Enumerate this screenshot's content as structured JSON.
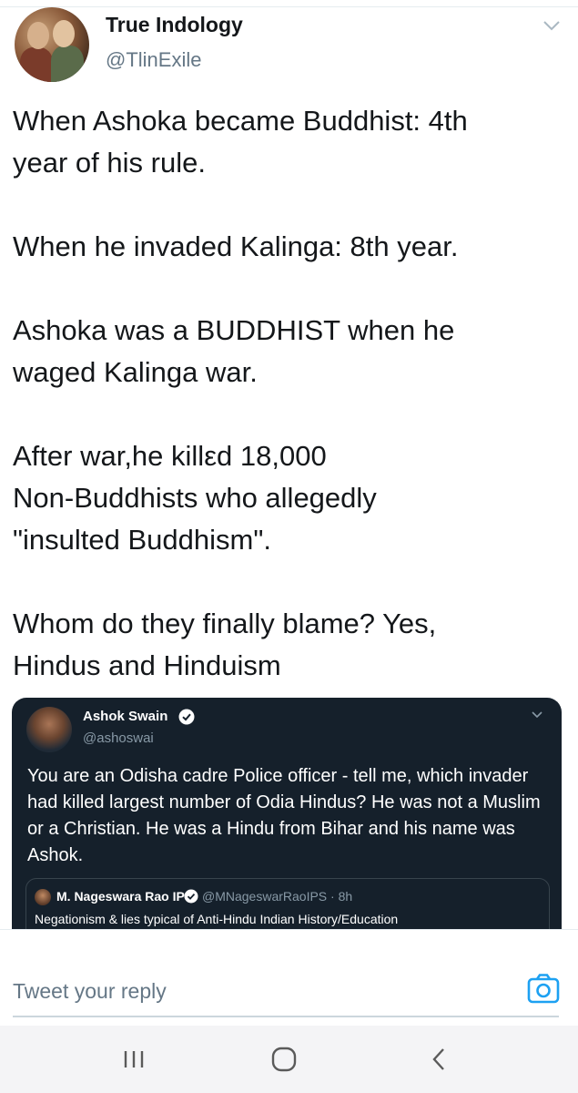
{
  "tweet": {
    "author_name": "True Indology",
    "author_handle": "@TlinExile",
    "text": "When Ashoka became Buddhist: 4th\nyear of his rule.\n\nWhen he invaded Kalinga: 8th year.\n\nAshoka was a BUDDHIST when he\nwaged Kalinga war.\n\nAfter war,he killεd 18,000\nNon-Buddhists who allegedly\n\"insulted Buddhism\".\n\nWhom do they finally blame? Yes,\nHindus and Hinduism"
  },
  "quoted_tweet": {
    "author_name": "Ashok Swain",
    "author_handle": "@ashoswai",
    "text": "You are an Odisha cadre Police officer - tell me, which invader had killed largest number of Odia Hindus? He was not a Muslim or a Christian. He was a Hindu from Bihar and his name was Ashok.",
    "nested_quote": {
      "author_name": "M. Nageswara Rao IPS",
      "author_handle_time": "@MNageswarRaoIPS · 8h",
      "text": "Negationism & lies typical of Anti-Hindu Indian History/Education"
    }
  },
  "reply": {
    "placeholder": "Tweet your reply"
  },
  "icons": {
    "more": "chevron-down-icon",
    "verified": "verified-badge-icon",
    "camera": "camera-icon",
    "recent_apps": "recent-apps-icon",
    "home": "home-icon",
    "back": "back-icon"
  },
  "colors": {
    "twitter_blue": "#1da1f2",
    "dark_card": "#15202b",
    "secondary_text": "#657786"
  }
}
